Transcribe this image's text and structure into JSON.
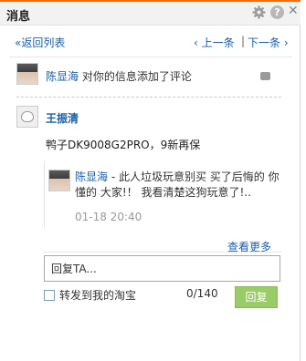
{
  "window": {
    "title": "消息",
    "help_label": "?",
    "close_label": "✕"
  },
  "nav": {
    "back_label": "«返回列表",
    "prev_label": "‹ 上一条",
    "separator": "|",
    "next_label": "下一条 ›"
  },
  "notice": {
    "user": "陈显海",
    "text": " 对你的信息添加了评论"
  },
  "post": {
    "author": "王振清",
    "text": "鸭子DK9008G2PRO，9新再保"
  },
  "reply": {
    "user": "陈显海",
    "text": " - 此人垃圾玩意别买 买了后悔的 你懂的 大家!！ 我看清楚这狗玩意了!..",
    "time": "01-18 20:40"
  },
  "more_label": "查看更多",
  "composer": {
    "value": "回复TA...",
    "forward_label": "转发到我的淘宝",
    "counter": "0/140",
    "send_label": "回复"
  },
  "colors": {
    "accent": "#ff6a00",
    "link": "#1a5fa8",
    "send_button": "#99cc66"
  }
}
